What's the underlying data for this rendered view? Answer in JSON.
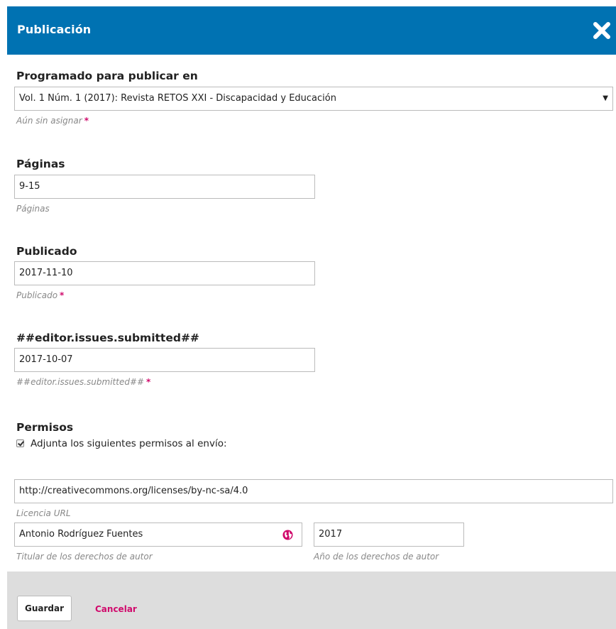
{
  "header": {
    "title": "Publicación"
  },
  "issue": {
    "label": "Programado para publicar en",
    "selected": "Vol. 1 Núm. 1 (2017): Revista RETOS XXI - Discapacidad y Educación",
    "caret": "▼",
    "help": "Aún sin asignar",
    "required_mark": "*"
  },
  "pages": {
    "label": "Páginas",
    "value": "9-15",
    "help": "Páginas"
  },
  "published": {
    "label": "Publicado",
    "value": "2017-11-10",
    "help": "Publicado",
    "required_mark": "*"
  },
  "submitted": {
    "label": "##editor.issues.submitted##",
    "value": "2017-10-07",
    "help": "##editor.issues.submitted##",
    "required_mark": "*"
  },
  "permissions": {
    "label": "Permisos",
    "checkbox_label": "Adjunta los siguientes permisos al envío:",
    "checked": true,
    "license_url": {
      "value": "http://creativecommons.org/licenses/by-nc-sa/4.0",
      "help": "Licencia URL"
    },
    "copyright_holder": {
      "value": "Antonio Rodríguez Fuentes",
      "help": "Titular de los derechos de autor"
    },
    "copyright_year": {
      "value": "2017",
      "help": "Año de los derechos de autor"
    }
  },
  "footer": {
    "save_label": "Guardar",
    "cancel_label": "Cancelar"
  },
  "colors": {
    "header_bg": "#0072b2",
    "accent": "#d00a6c",
    "footer_bg": "#dddddd"
  },
  "icons": {
    "close": "close-icon",
    "globe": "globe-icon",
    "dropdown": "chevron-down-icon"
  }
}
